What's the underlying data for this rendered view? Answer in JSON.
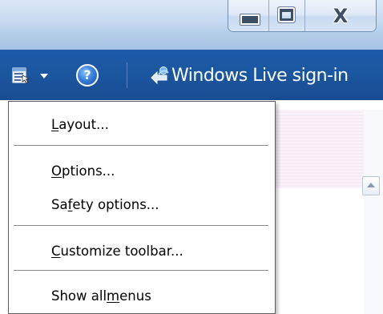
{
  "window": {
    "caption_close": "X"
  },
  "commandbar": {
    "help_glyph": "?",
    "live_signin_label": "Windows Live sign-in"
  },
  "icons": {
    "tools": "tools-icon",
    "dropdown": "chevron-down-icon",
    "help": "help-icon",
    "live": "windows-live-icon",
    "minimize": "minimize-icon",
    "maximize": "maximize-icon",
    "close": "close-icon",
    "scroll_up": "arrow-up-icon"
  },
  "colors": {
    "commandbar_bg": "#1b56a0",
    "titlebar_bg": "#c7daf0",
    "menu_border": "#5e5e5e",
    "separator": "#8a8a8a"
  },
  "menu": {
    "items": [
      {
        "label": "Layout...",
        "mnemonic": "L",
        "before": "",
        "after": "ayout..."
      },
      {
        "label": "Options...",
        "mnemonic": "O",
        "before": "",
        "after": "ptions..."
      },
      {
        "label": "Safety options...",
        "mnemonic": "f",
        "before": "Sa",
        "after": "ety options..."
      },
      {
        "label": "Customize toolbar...",
        "mnemonic": "C",
        "before": "",
        "after": "ustomize toolbar..."
      },
      {
        "label": "Show all menus",
        "mnemonic": "m",
        "before": "Show all ",
        "after": "enus"
      }
    ]
  }
}
